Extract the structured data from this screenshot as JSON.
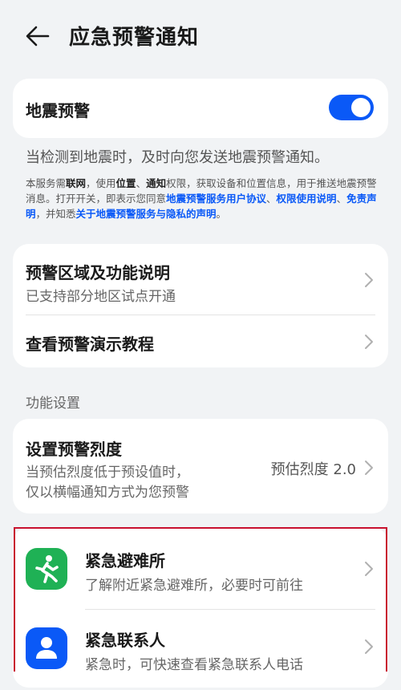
{
  "header": {
    "title": "应急预警通知",
    "back_icon": "arrow-left-icon"
  },
  "earthquake": {
    "label": "地震预警",
    "enabled": true,
    "accent": "#0a59f7"
  },
  "description": "当检测到地震时，及时向您发送地震预警通知。",
  "notice": {
    "p1": "本服务需",
    "net": "联网",
    "p2": "，使用",
    "loc": "位置",
    "p3": "、",
    "notif": "通知",
    "p4": "权限，获取设备和位置信息，用于推送地震预警消息。打开开关，即表示您同意",
    "link1": "地震预警服务用户协议",
    "p5": "、",
    "link2": "权限使用说明",
    "p6": "、",
    "link3": "免责声明",
    "p7": "，并知悉",
    "link4": "关于地震预警服务与隐私的声明",
    "p8": "。"
  },
  "info_card": {
    "region_title": "预警区域及功能说明",
    "region_sub": "已支持部分地区试点开通",
    "tutorial_title": "查看预警演示教程"
  },
  "section_label": "功能设置",
  "intensity": {
    "title": "设置预警烈度",
    "sub1": "当预估烈度低于预设值时，",
    "sub2": "仅以横幅通知方式为您预警",
    "value": "预估烈度 2.0"
  },
  "emergency": {
    "shelter_title": "紧急避难所",
    "shelter_sub": "了解附近紧急避难所，必要时可前往",
    "shelter_icon_color": "#1fb155",
    "contact_title": "紧急联系人",
    "contact_sub": "紧急时，可快速查看紧急联系人电话",
    "contact_icon_color": "#0a59f7",
    "highlight_color": "#c8102e"
  }
}
